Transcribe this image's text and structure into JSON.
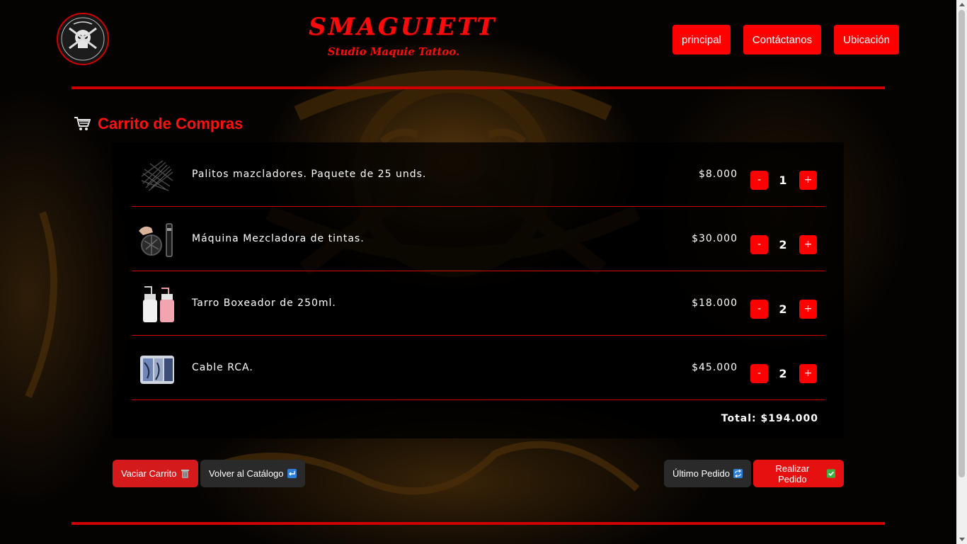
{
  "header": {
    "brand_title": "SMAGUIETT",
    "brand_subtitle": "Studio Maquie Tattoo.",
    "nav": [
      "principal",
      "Contáctanos",
      "Ubicación"
    ]
  },
  "cart": {
    "title": "Carrito de Compras",
    "items": [
      {
        "name": "Palitos mazcladores. Paquete de 25 unds.",
        "price": "$8.000",
        "qty": "1",
        "icon": "mixing-sticks-image"
      },
      {
        "name": "Máquina Mezcladora de tintas.",
        "price": "$30.000",
        "qty": "2",
        "icon": "ink-mixer-image"
      },
      {
        "name": "Tarro Boxeador de 250ml.",
        "price": "$18.000",
        "qty": "2",
        "icon": "squeeze-bottles-image"
      },
      {
        "name": "Cable RCA.",
        "price": "$45.000",
        "qty": "2",
        "icon": "rca-cable-image"
      }
    ],
    "minus_label": "-",
    "plus_label": "+",
    "total": "Total: $194.000"
  },
  "actions": {
    "empty_cart": "Vaciar Carrito",
    "back_catalog": "Volver al Catálogo",
    "last_order": "Último Pedido",
    "place_order": "Realizar Pedido"
  },
  "colors": {
    "accent": "#ff0000",
    "dark_button": "#2a2a2a",
    "background": "#050302"
  }
}
